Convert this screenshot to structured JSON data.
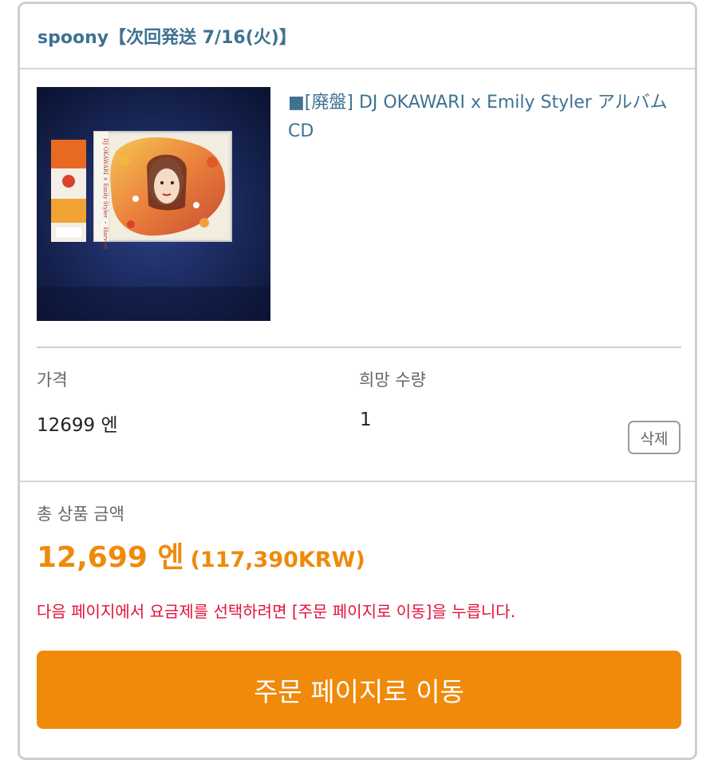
{
  "shop": {
    "name": "spoony【次回発送 7/16(火)】"
  },
  "item": {
    "title": "■[廃盤] DJ OKAWARI x Emily Styler アルバムCD",
    "image_icon": "album-cd-photo",
    "image_text": {
      "spine": "DJ OKAWARI × Emily Styler ・ Harvest"
    },
    "price_label": "가격",
    "price_value": "12699 엔",
    "quantity_label": "희망 수량",
    "quantity_value": "1",
    "delete_label": "삭제"
  },
  "summary": {
    "total_label": "총 상품 금액",
    "total_amount": "12,699 엔",
    "total_krw": "(117,390KRW)",
    "notice": "다음 페이지에서 요금제를 선택하려면 [주문 페이지로 이동]을 누릅니다.",
    "order_button_label": "주문 페이지로 이동"
  },
  "colors": {
    "link": "#3f7291",
    "accent": "#ef8a0a",
    "notice": "#e3123b"
  }
}
